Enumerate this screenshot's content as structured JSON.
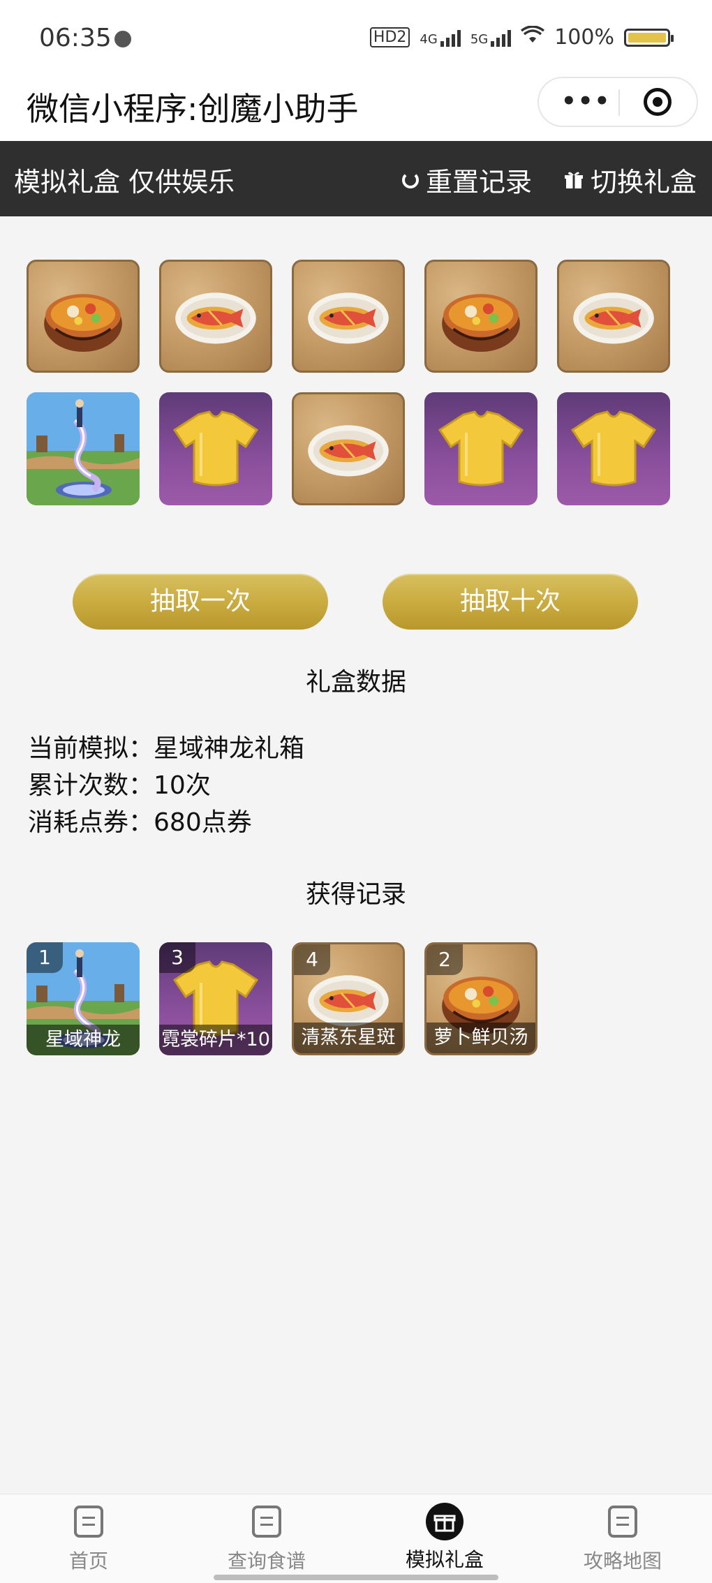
{
  "status_bar": {
    "time": "06:35",
    "battery": "100%",
    "network": [
      "HD2",
      "4G",
      "5G"
    ]
  },
  "title_bar": {
    "title": "微信小程序:创魔小助手",
    "more_icon": "more-dots-icon",
    "close_icon": "target-icon"
  },
  "header": {
    "label": "模拟礼盒 仅供娱乐",
    "reset_label": "重置记录",
    "switch_label": "切换礼盒"
  },
  "results_grid": {
    "items": [
      {
        "type": "soup"
      },
      {
        "type": "fish"
      },
      {
        "type": "fish"
      },
      {
        "type": "soup"
      },
      {
        "type": "fish"
      },
      {
        "type": "dragon"
      },
      {
        "type": "shirt"
      },
      {
        "type": "fish"
      },
      {
        "type": "shirt"
      },
      {
        "type": "shirt"
      }
    ]
  },
  "buttons": {
    "draw_once": "抽取一次",
    "draw_ten": "抽取十次"
  },
  "stats": {
    "title": "礼盒数据",
    "current_label": "当前模拟：",
    "current_value": "星域神龙礼箱",
    "count_label": "累计次数：",
    "count_value": "10次",
    "cost_label": "消耗点券：",
    "cost_value": "680点券"
  },
  "records": {
    "title": "获得记录",
    "items": [
      {
        "count": "1",
        "name": "星域神龙",
        "type": "dragon"
      },
      {
        "count": "3",
        "name": "霓裳碎片*10",
        "type": "shirt"
      },
      {
        "count": "4",
        "name": "清蒸东星斑",
        "type": "fish"
      },
      {
        "count": "2",
        "name": "萝卜鲜贝汤",
        "type": "soup"
      }
    ]
  },
  "tab_bar": {
    "tabs": [
      {
        "label": "首页",
        "active": false
      },
      {
        "label": "查询食谱",
        "active": false
      },
      {
        "label": "模拟礼盒",
        "active": true
      },
      {
        "label": "攻略地图",
        "active": false
      }
    ]
  },
  "colors": {
    "header_bg": "#2f2f2f",
    "button_gold": "#c8aa3e",
    "wood": "#c59b66",
    "purple": "#8a4f9c"
  }
}
